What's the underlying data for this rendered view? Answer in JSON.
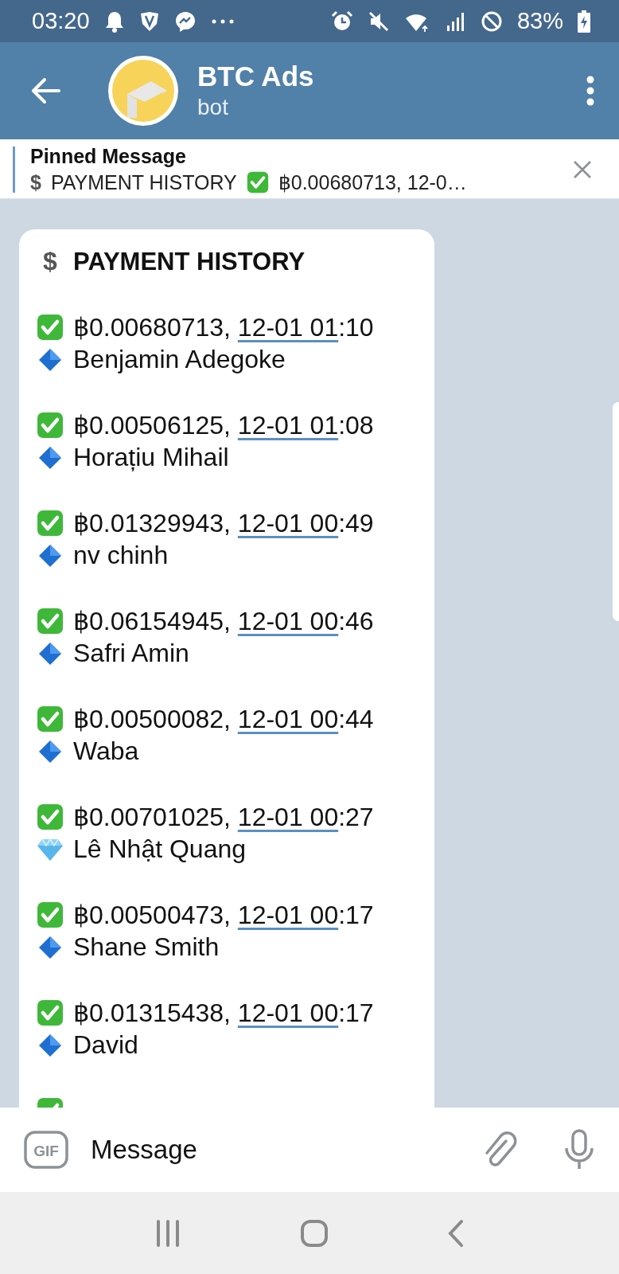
{
  "status_bar": {
    "time": "03:20",
    "battery": "83%"
  },
  "header": {
    "title": "BTC Ads",
    "subtitle": "bot"
  },
  "pinned": {
    "label": "Pinned Message",
    "icon_char": "$",
    "title": "PAYMENT HISTORY",
    "preview": "฿0.00680713, 12-0…"
  },
  "message": {
    "icon_char": "$",
    "title": "PAYMENT HISTORY",
    "rows": [
      {
        "kind": "diamond",
        "amount": "฿0.00680713, ",
        "date": "12-01 01",
        "time_rest": ":10",
        "name": "Benjamin Adegoke"
      },
      {
        "kind": "diamond",
        "amount": "฿0.00506125, ",
        "date": "12-01 01",
        "time_rest": ":08",
        "name": "Horațiu Mihail"
      },
      {
        "kind": "diamond",
        "amount": "฿0.01329943, ",
        "date": "12-01 00",
        "time_rest": ":49",
        "name": "nv chinh"
      },
      {
        "kind": "diamond",
        "amount": "฿0.06154945, ",
        "date": "12-01 00",
        "time_rest": ":46",
        "name": "Safri Amin"
      },
      {
        "kind": "diamond",
        "amount": "฿0.00500082, ",
        "date": "12-01 00",
        "time_rest": ":44",
        "name": "Waba"
      },
      {
        "kind": "gem",
        "amount": "฿0.00701025, ",
        "date": "12-01 00",
        "time_rest": ":27",
        "name": "Lê Nhật Quang"
      },
      {
        "kind": "diamond",
        "amount": "฿0.00500473, ",
        "date": "12-01 00",
        "time_rest": ":17",
        "name": "Shane Smith"
      },
      {
        "kind": "diamond",
        "amount": "฿0.01315438, ",
        "date": "12-01 00",
        "time_rest": ":17",
        "name": "David"
      },
      {
        "kind": "cut"
      }
    ]
  },
  "composer": {
    "gif_label": "GIF",
    "placeholder": "Message"
  }
}
